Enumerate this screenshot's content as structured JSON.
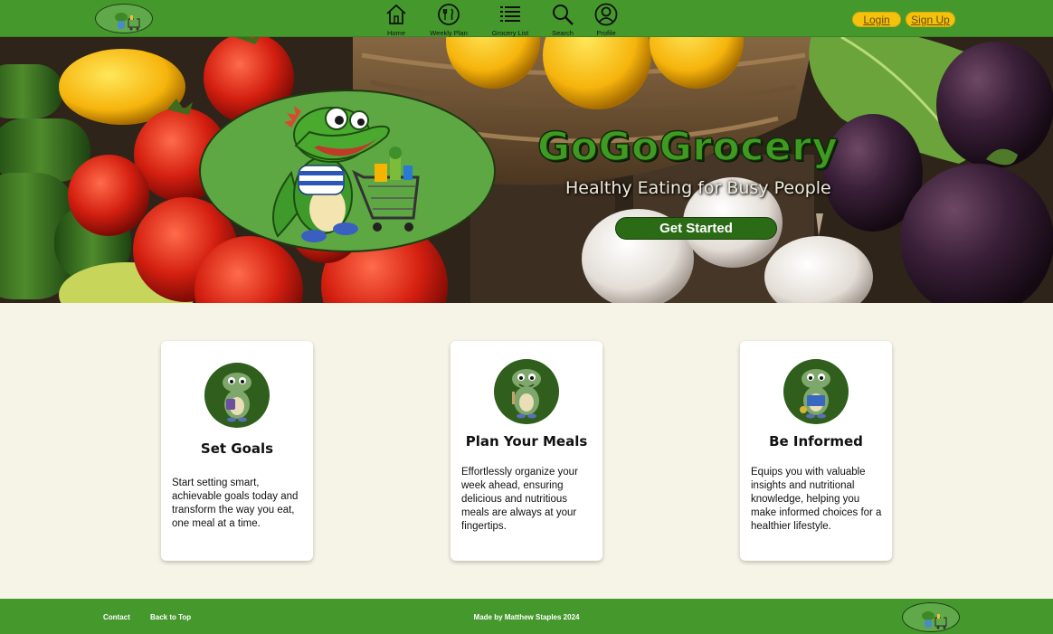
{
  "header": {
    "logo_icon": "gator-cart-icon",
    "nav": [
      {
        "label": "Home",
        "icon": "home-icon"
      },
      {
        "label": "Weekly Plan",
        "icon": "utensils-icon"
      },
      {
        "label": "Grocery List",
        "icon": "list-icon"
      },
      {
        "label": "Search",
        "icon": "search-icon"
      },
      {
        "label": "Profile",
        "icon": "user-icon"
      }
    ],
    "login_label": "Login",
    "signup_label": "Sign Up"
  },
  "hero": {
    "title": "GoGoGrocery",
    "subtitle": "Healthy Eating for Busy People",
    "cta_label": "Get Started"
  },
  "cards": [
    {
      "title": "Set Goals",
      "text": "Start setting smart, achievable goals today and transform the way you eat, one meal at a time."
    },
    {
      "title": "Plan Your Meals",
      "text": "Effortlessly organize your week ahead, ensuring delicious and nutritious meals are always at your fingertips."
    },
    {
      "title": "Be Informed",
      "text": "Equips you with valuable insights and nutritional knowledge, helping you make informed choices for a healthier lifestyle."
    }
  ],
  "footer": {
    "contact_label": "Contact",
    "back_to_top_label": "Back to Top",
    "credit": "Made by Matthew Staples 2024"
  },
  "colors": {
    "brand_green": "#45992c",
    "button_yellow": "#f4c20d",
    "cta_green": "#2c6b16",
    "page_bg": "#f6f4e6"
  }
}
